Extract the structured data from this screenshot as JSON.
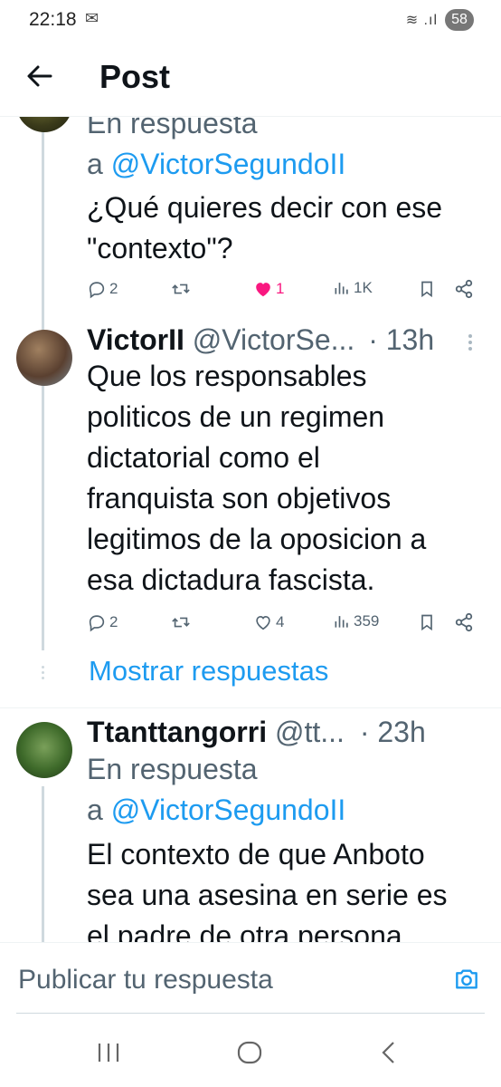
{
  "status_bar": {
    "time": "22:18",
    "battery": "58"
  },
  "header": {
    "title": "Post"
  },
  "tweets": [
    {
      "reply_to_prefix": "En respuesta",
      "reply_to_a": "a",
      "reply_to_handle": "@VictorSegundoII",
      "text_lines": [
        "¿Qué quieres decir con ese",
        "\"contexto\"?"
      ],
      "replies": "2",
      "likes": "1",
      "views": "1K",
      "liked": true
    },
    {
      "name": "VictorII",
      "handle": "@VictorSe...",
      "time": "· 13h",
      "text_lines": [
        "Que los responsables",
        "politicos de un regimen",
        "dictatorial como el",
        "franquista son objetivos",
        "legitimos de la oposicion a",
        "esa dictadura fascista."
      ],
      "replies": "2",
      "likes": "4",
      "views": "359"
    },
    {
      "name": "Ttanttangorri",
      "handle": "@tt...",
      "time": "· 23h",
      "reply_to_prefix": "En respuesta",
      "reply_to_a": "a",
      "reply_to_handle": "@VictorSegundoII",
      "text_lines": [
        "El contexto de que Anboto",
        "sea una asesina en serie es",
        "el padre de otra persona"
      ]
    }
  ],
  "show_replies": "Mostrar respuestas",
  "reply_box": {
    "placeholder": "Publicar tu respuesta"
  },
  "colors": {
    "accent": "#1d9bf0",
    "like": "#f91880",
    "muted": "#536471"
  }
}
